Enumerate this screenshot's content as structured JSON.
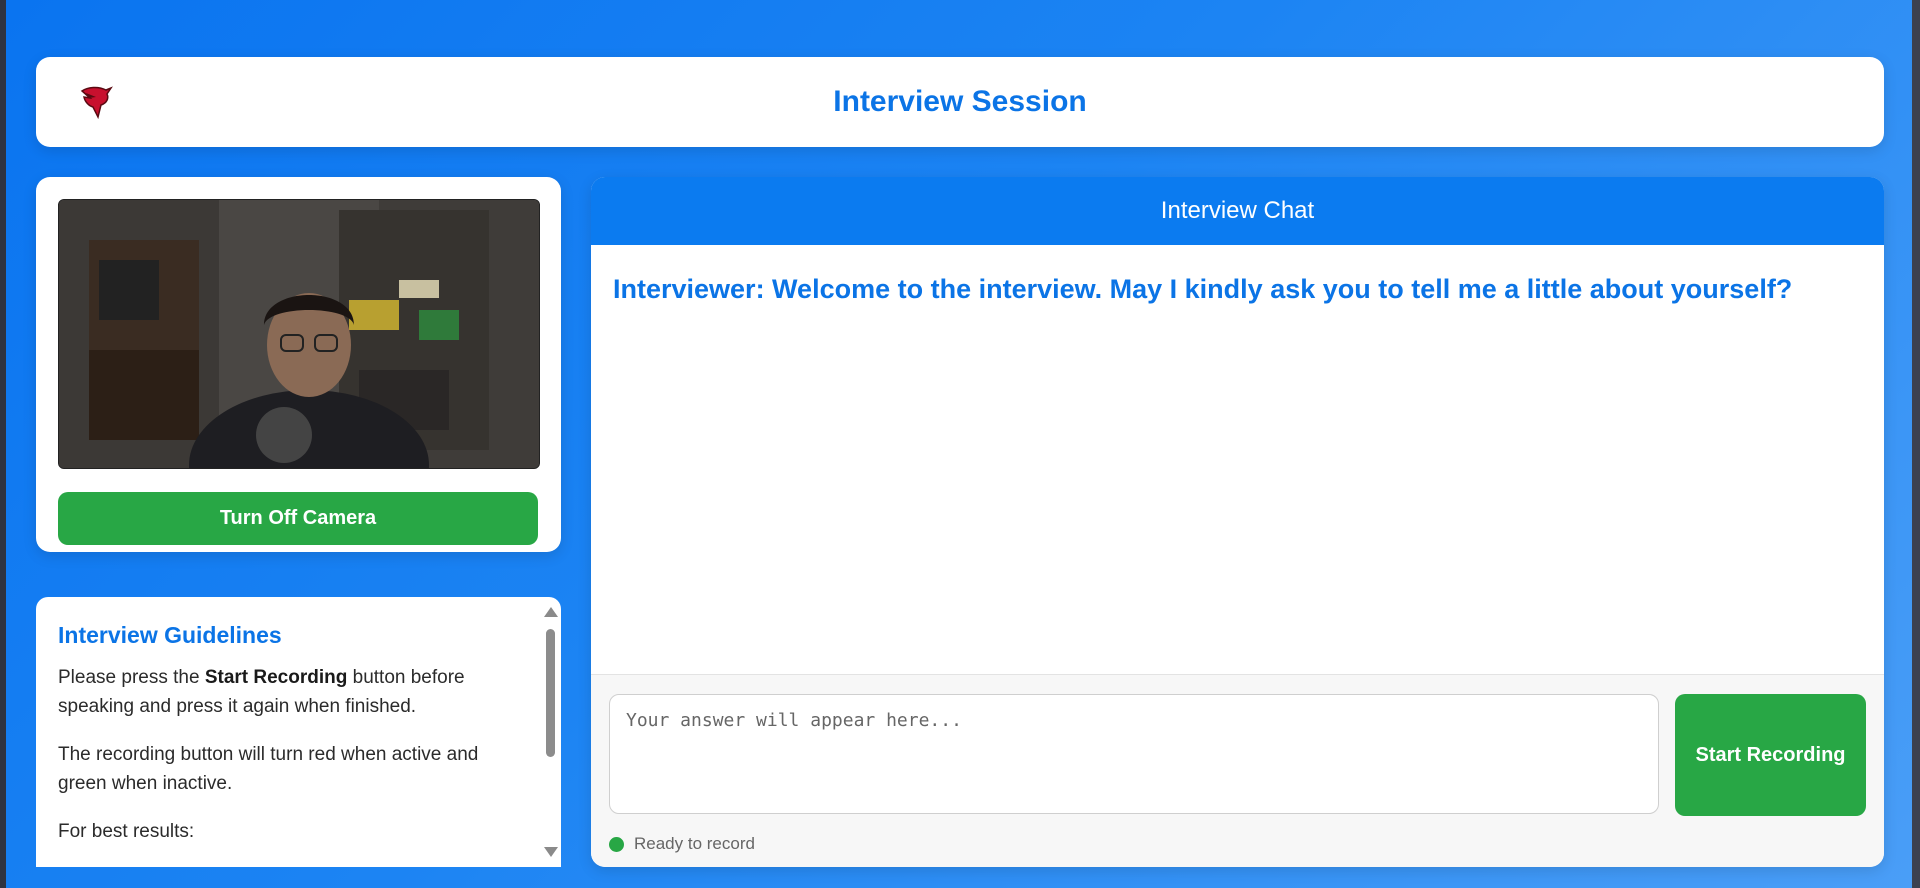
{
  "header": {
    "title": "Interview Session",
    "logo_icon": "red-bird-logo-icon"
  },
  "camera": {
    "toggle_label": "Turn Off Camera",
    "button_color": "#28a745"
  },
  "guidelines": {
    "title": "Interview Guidelines",
    "p1_before": "Please press the ",
    "p1_bold": "Start Recording",
    "p1_after": " button before speaking and press it again when finished.",
    "p2": "The recording button will turn red when active and green when inactive.",
    "p3": "For best results:"
  },
  "chat": {
    "header": "Interview Chat",
    "messages": [
      {
        "text": "Interviewer: Welcome to the interview. May I kindly ask you to tell me a little about yourself?"
      }
    ],
    "answer_placeholder": "Your answer will appear here...",
    "record_label": "Start Recording",
    "status_text": "Ready to record",
    "status_color": "#28a745"
  },
  "colors": {
    "accent": "#0b74e6",
    "header_bar": "#0b7bf0",
    "success": "#28a745"
  }
}
